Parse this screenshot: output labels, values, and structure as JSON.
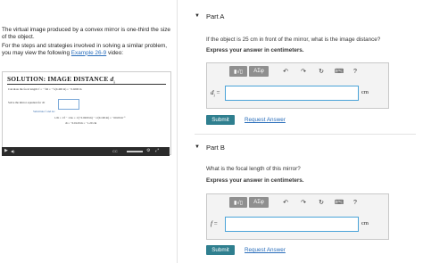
{
  "intro": {
    "line1": "The virtual image produced by a convex mirror is one-third the size of the object.",
    "line2_prefix": "For the steps and strategies involved in solving a similar problem, you may view the following ",
    "link": "Example 26-9",
    "line2_suffix": " video:"
  },
  "video": {
    "title": "SOLUTION: IMAGE DISTANCE ",
    "title_var": "d",
    "title_sub": "i",
    "line1": "Calculate the focal length:   f = −½R = −½(0.400 m) = −0.0200 m",
    "line2": "Solve the mirror equation for di:",
    "line3": "Substitute f and do:",
    "line4": "1/di = 1/f − 1/do = 1/(−0.0200 m) − 1/(0.100 m) = −60.00 m⁻¹",
    "line5": "di = −0.0120 m = −1.20 cm"
  },
  "partA": {
    "label": "Part A",
    "question": "If the object is 25 cm in front of the mirror, what is the image distance?",
    "instruction": "Express your answer in centimeters.",
    "variable": "d",
    "variable_sub": "i",
    "eq": "=",
    "value": "",
    "unit": "cm",
    "submit": "Submit",
    "request": "Request Answer"
  },
  "partB": {
    "label": "Part B",
    "question": "What is the focal length of this mirror?",
    "instruction": "Express your answer in centimeters.",
    "variable": "f",
    "eq": "=",
    "value": "",
    "unit": "cm",
    "submit": "Submit",
    "request": "Request Answer"
  },
  "toolbar": {
    "template": "▮√▯",
    "greek": "ΑΣφ",
    "undo": "↶",
    "redo": "↷",
    "reset": "↻",
    "keyboard": "⌨",
    "help": "?"
  }
}
